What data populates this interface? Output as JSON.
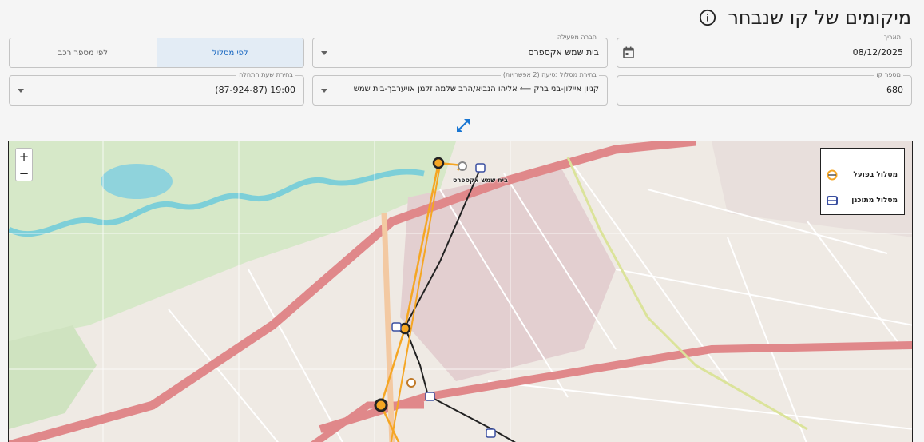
{
  "header": {
    "title": "מיקומים של קו שנבחר",
    "info_icon": "info-circle-icon"
  },
  "filters": {
    "date": {
      "label": "תאריך",
      "value": "08/12/2025",
      "icon": "calendar-icon"
    },
    "operator": {
      "label": "חברה מפעילה",
      "value": "בית שמש אקספרס"
    },
    "mode_toggle": {
      "by_route": "לפי מסלול",
      "by_vehicle": "לפי מספר רכב",
      "selected": "by_route"
    },
    "line_number": {
      "label": "מספר קו",
      "value": "680"
    },
    "route": {
      "label": "בחירת מסלול נסיעה (2 אפשרויות)",
      "value": "קניון איילון-בני ברק ⟵ אליהו הנביא/הרב שלמה זלמן אויערבך-בית שמש"
    },
    "start_time": {
      "label": "בחירת שעת התחלה",
      "value": "19:00 (87-924-87)"
    }
  },
  "map": {
    "expand_icon": "expand-arrows-icon",
    "zoom_in": "+",
    "zoom_out": "−",
    "stop_label": "בית שמש אקספרס",
    "legend": {
      "actual": "מסלול בפועל",
      "planned": "מסלול מתוכנן"
    },
    "colors": {
      "actual": "#f5a623",
      "planned": "#222222",
      "accent": "#1976d2"
    }
  }
}
